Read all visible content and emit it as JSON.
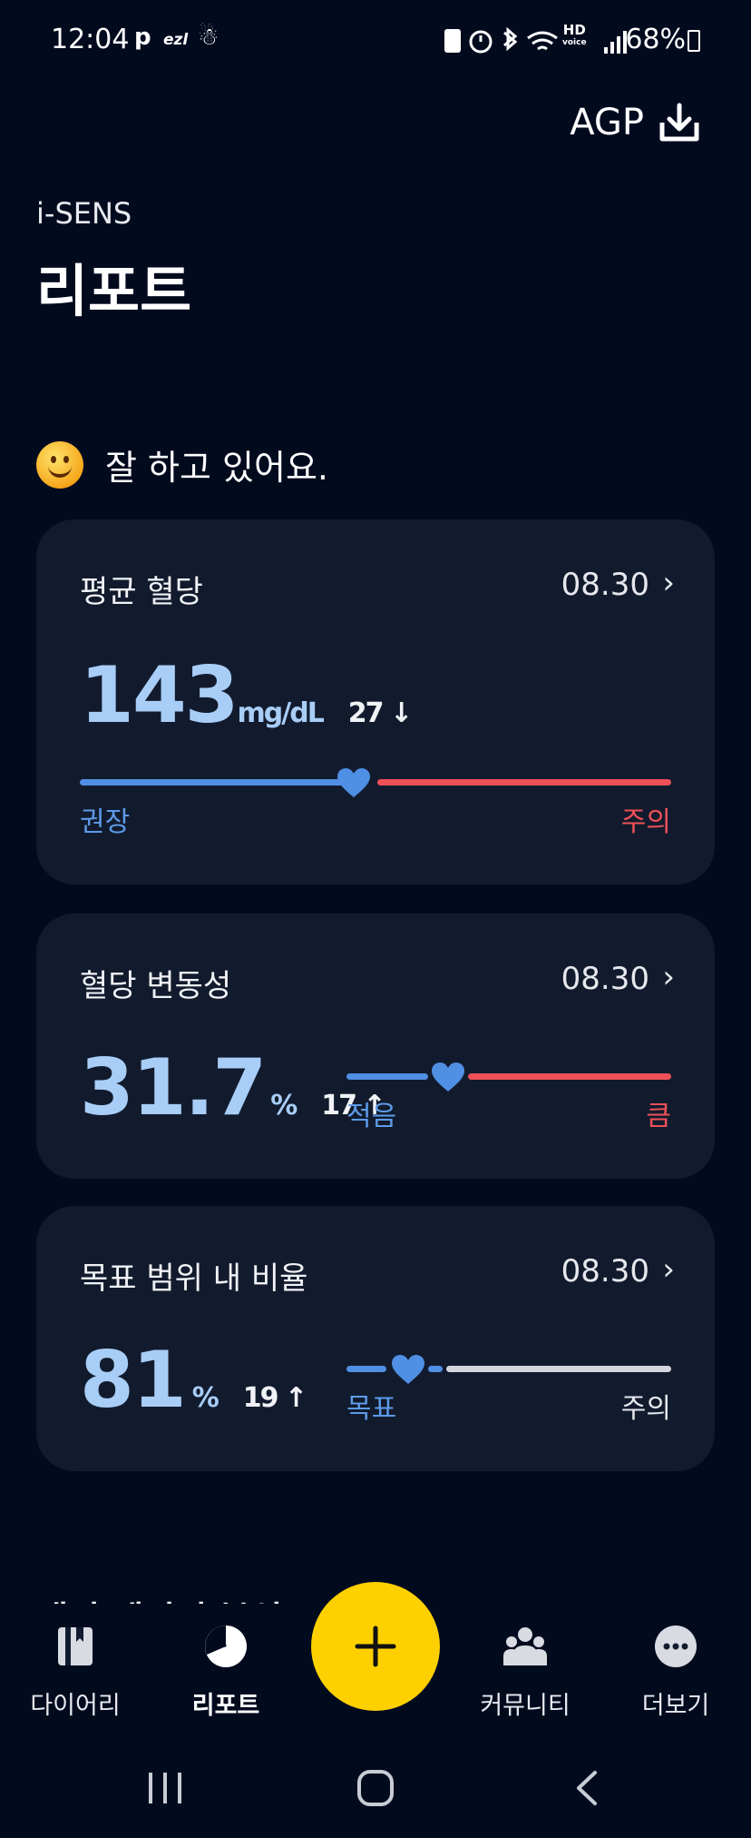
{
  "status_bar": {
    "time": "12:04",
    "left_icons": [
      "p",
      "ezl",
      "☃"
    ],
    "battery": "68%",
    "hd_label": "HD",
    "voice_label": "voice"
  },
  "header": {
    "agp_label": "AGP",
    "brand": "i-SENS",
    "title": "리포트"
  },
  "summary": {
    "icon": "smiley-icon",
    "text": "잘 하고 있어요."
  },
  "cards": [
    {
      "label": "평균 혈당",
      "date": "08.30",
      "value": "143",
      "unit": "mg/dL",
      "delta": "27",
      "delta_arrow": "↓",
      "slider_left": "권장",
      "slider_right": "주의",
      "slider_position": 0.46
    },
    {
      "label": "혈당 변동성",
      "date": "08.30",
      "value": "31.7",
      "unit": "%",
      "delta": "17",
      "delta_arrow": "↑",
      "slider_left": "적음",
      "slider_right": "큼",
      "slider_position": 0.32
    },
    {
      "label": "목표 범위 내 비율",
      "date": "08.30",
      "value": "81",
      "unit": "%",
      "delta": "19",
      "delta_arrow": "↑",
      "slider_left": "목표",
      "slider_right": "주의",
      "slider_position": 0.19
    }
  ],
  "teaser": "패턴 데이터 분석",
  "nav": {
    "items": [
      {
        "label": "다이어리",
        "icon": "diary-icon"
      },
      {
        "label": "리포트",
        "icon": "report-icon",
        "active": true
      },
      {
        "label": "커뮤니티",
        "icon": "community-icon"
      },
      {
        "label": "더보기",
        "icon": "more-icon"
      }
    ],
    "fab_icon": "plus-icon"
  },
  "colors": {
    "background": "#020a1e",
    "card": "#121b2d",
    "value": "#a8cdf7",
    "blue": "#4f8fe4",
    "red": "#ef5058",
    "fab": "#ffd000"
  }
}
